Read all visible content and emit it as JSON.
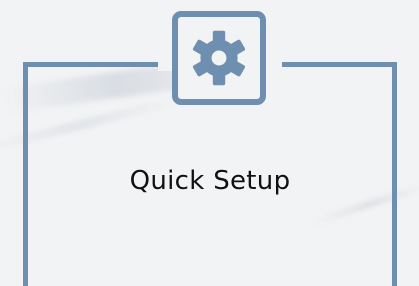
{
  "card": {
    "title": "Quick Setup",
    "icon": "gear-icon"
  },
  "colors": {
    "accent": "#6e8fb0",
    "background": "#f2f3f4",
    "text": "#111111"
  }
}
